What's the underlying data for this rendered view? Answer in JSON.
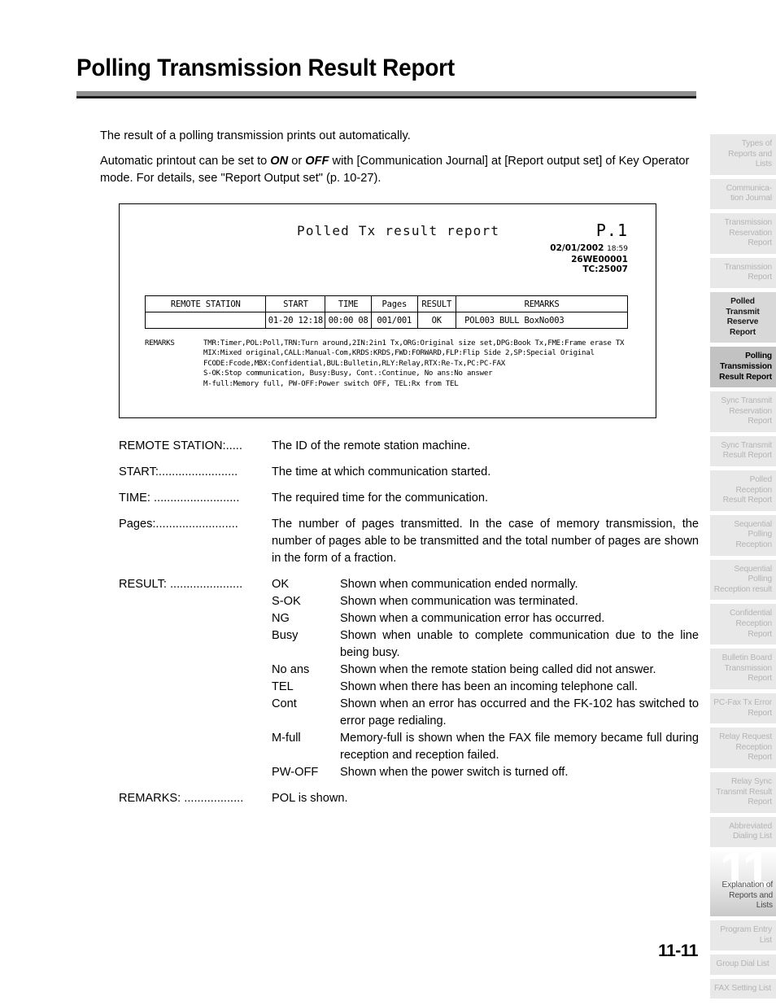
{
  "page": {
    "title": "Polling Transmission Result Report",
    "footer_page_number": "11-11"
  },
  "intro": {
    "line1": "The result of a polling transmission prints out automatically.",
    "line2_part1": "Automatic printout can be set to ",
    "line2_on": "ON",
    "line2_or": " or ",
    "line2_off": "OFF",
    "line2_part2": " with [Communication Journal] at [Report output set] of Key Operator mode. For details, see \"Report Output set\" (p. 10-27)."
  },
  "fax_report": {
    "doc_title": "Polled Tx result report",
    "page_label": "P.1",
    "date": "02/01/2002",
    "time": "18:59",
    "machine_id": "26WE00001",
    "tc": "TC:25007",
    "table": {
      "headers": [
        "REMOTE STATION",
        "START",
        "TIME",
        "Pages",
        "RESULT",
        "REMARKS"
      ],
      "rows": [
        {
          "remote_station": "",
          "start": "01-20 12:18",
          "time": "00:00 08",
          "pages": "001/001",
          "result": "OK",
          "remarks": "POL003 BULL BoxNo003"
        }
      ]
    },
    "legend_label": "REMARKS",
    "legend_lines": [
      "TMR:Timer,POL:Poll,TRN:Turn around,2IN:2in1 Tx,ORG:Original size set,DPG:Book Tx,FME:Frame erase TX",
      "MIX:Mixed original,CALL:Manual-Com,KRDS:KRDS,FWD:FORWARD,FLP:Flip Side 2,SP:Special Original",
      "FCODE:Fcode,MBX:Confidential,BUL:Bulletin,RLY:Relay,RTX:Re-Tx,PC:PC-FAX",
      "S-OK:Stop communication, Busy:Busy, Cont.:Continue, No ans:No answer",
      "M-full:Memory full, PW-OFF:Power switch OFF, TEL:Rx from TEL"
    ]
  },
  "definitions": [
    {
      "term": "REMOTE STATION:.....",
      "desc": "The ID of the remote station machine."
    },
    {
      "term": "START:........................",
      "desc": "The time at which communication started."
    },
    {
      "term": "TIME: ..........................",
      "desc": "The required time for the communication."
    },
    {
      "term": "Pages:.........................",
      "desc": "The number of pages transmitted. In the case of memory transmission, the number of pages able to be transmitted and the total number of pages are shown in the form of a fraction."
    }
  ],
  "result": {
    "term": "RESULT: ......................",
    "entries": [
      {
        "code": "OK",
        "desc": "Shown when communication ended normally."
      },
      {
        "code": "S-OK",
        "desc": "Shown when communication was terminated."
      },
      {
        "code": "NG",
        "desc": "Shown when a communication error has occurred."
      },
      {
        "code": "Busy",
        "desc": "Shown when unable to complete communication due to the line being busy."
      },
      {
        "code": "No ans",
        "desc": "Shown when the remote station being called did not answer."
      },
      {
        "code": "TEL",
        "desc": "Shown when there has been an incoming telephone call."
      },
      {
        "code": "Cont",
        "desc": "Shown when an error has occurred and the FK-102 has switched to error page redialing."
      },
      {
        "code": "M-full",
        "desc": "Memory-full is shown when the FAX file memory became full during reception and reception failed."
      },
      {
        "code": "PW-OFF",
        "desc": "Shown when the power switch is turned off."
      }
    ]
  },
  "remarks_def": {
    "term": "REMARKS: ..................",
    "desc": "POL is shown."
  },
  "tab_rail": {
    "items": [
      {
        "label": "Types of Reports and Lists",
        "state": "inactive"
      },
      {
        "label": "Communica-tion Journal",
        "state": "inactive"
      },
      {
        "label": "Transmission Reservation Report",
        "state": "inactive"
      },
      {
        "label": "Transmission Report",
        "state": "inactive"
      },
      {
        "label": "Polled Transmit Reserve Report",
        "state": "prev-active"
      },
      {
        "label": "Polling Transmission Result Report",
        "state": "active"
      },
      {
        "label": "Sync Transmit Reservation Report",
        "state": "inactive"
      },
      {
        "label": "Sync Transmit Result Report",
        "state": "inactive"
      },
      {
        "label": "Polled Reception Result Report",
        "state": "inactive"
      },
      {
        "label": "Sequential Polling Reception",
        "state": "inactive"
      },
      {
        "label": "Sequential Polling Reception result",
        "state": "inactive"
      },
      {
        "label": "Confidential Reception Report",
        "state": "inactive"
      },
      {
        "label": "Bulletin Board Transmission Report",
        "state": "inactive"
      },
      {
        "label": "PC-Fax Tx Error Report",
        "state": "inactive"
      },
      {
        "label": "Relay Request Reception Report",
        "state": "inactive"
      },
      {
        "label": "Relay Sync Transmit Result Report",
        "state": "inactive"
      },
      {
        "label": "Abbreviated Dialing List",
        "state": "inactive"
      }
    ],
    "chapter": {
      "number": "11",
      "label": "Explanation of Reports and Lists"
    },
    "items_after": [
      {
        "label": "Program Entry List",
        "state": "inactive"
      },
      {
        "label": "Group Dial List",
        "state": "inactive",
        "center": true
      },
      {
        "label": "FAX Setting List",
        "state": "inactive",
        "center": true
      }
    ]
  }
}
